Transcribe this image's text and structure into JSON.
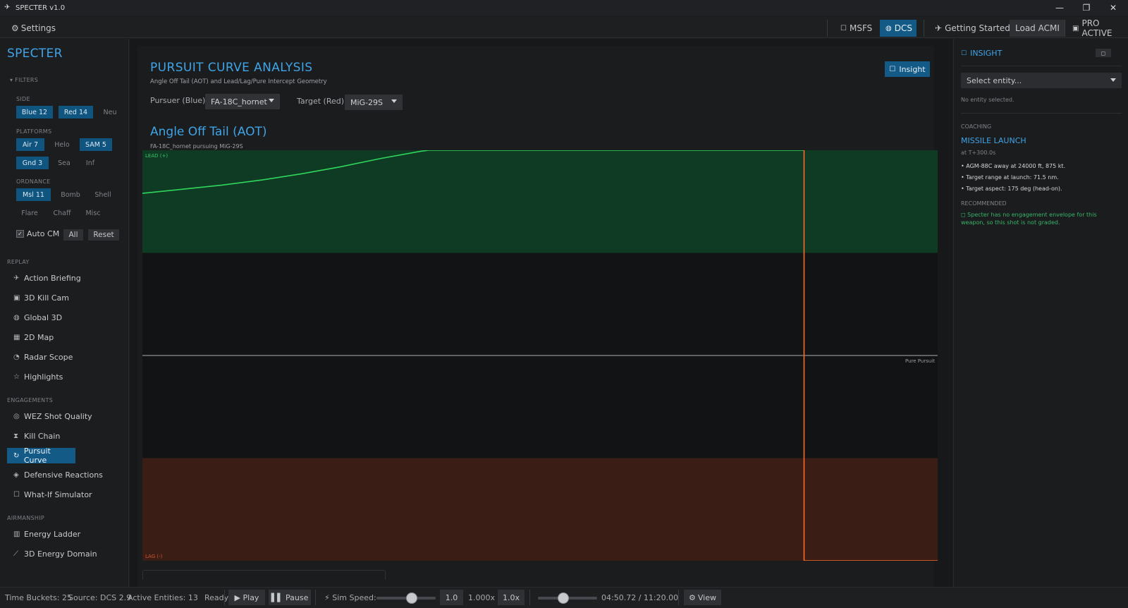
{
  "window": {
    "title": "SPECTER v1.0",
    "min": "—",
    "restore": "❐",
    "close": "✕"
  },
  "toolbar": {
    "settings": "Settings",
    "msfs": "MSFS",
    "dcs": "DCS",
    "getting_started": "Getting Started",
    "load_acmi": "Load ACMI",
    "pro": "PRO ACTIVE"
  },
  "sidebar": {
    "brand": "SPECTER",
    "filters_label": "FILTERS",
    "side_label": "SIDE",
    "side": [
      {
        "label": "Blue  12",
        "on": true
      },
      {
        "label": "Red  14",
        "on": true
      },
      {
        "label": "Neu",
        "on": false
      }
    ],
    "platforms_label": "PLATFORMS",
    "platforms": [
      {
        "label": "Air  7",
        "on": true
      },
      {
        "label": "Helo",
        "on": false
      },
      {
        "label": "SAM  5",
        "on": true
      },
      {
        "label": "Gnd  3",
        "on": true
      },
      {
        "label": "Sea",
        "on": false
      },
      {
        "label": "Inf",
        "on": false
      }
    ],
    "ordnance_label": "ORDNANCE",
    "ordnance": [
      {
        "label": "Msl  11",
        "on": true
      },
      {
        "label": "Bomb",
        "on": false
      },
      {
        "label": "Shell",
        "on": false
      },
      {
        "label": "Flare",
        "on": false
      },
      {
        "label": "Chaff",
        "on": false
      },
      {
        "label": "Misc",
        "on": false
      }
    ],
    "auto_cm": "Auto CM",
    "all": "All",
    "reset": "Reset",
    "replay_label": "REPLAY",
    "replay": [
      {
        "label": "Action Briefing",
        "icon": "jet-icon"
      },
      {
        "label": "3D Kill Cam",
        "icon": "camera-icon"
      },
      {
        "label": "Global 3D",
        "icon": "globe-icon"
      },
      {
        "label": "2D Map",
        "icon": "map-icon"
      },
      {
        "label": "Radar Scope",
        "icon": "radar-icon"
      },
      {
        "label": "Highlights",
        "icon": "star-icon"
      }
    ],
    "engagements_label": "ENGAGEMENTS",
    "engagements": [
      {
        "label": "WEZ Shot Quality",
        "icon": "target-icon"
      },
      {
        "label": "Kill Chain",
        "icon": "hourglass-icon"
      },
      {
        "label": "Pursuit Curve",
        "icon": "sync-icon",
        "active": true
      },
      {
        "label": "Defensive Reactions",
        "icon": "shield-icon"
      },
      {
        "label": "What-If Simulator",
        "icon": "square-icon"
      }
    ],
    "airmanship_label": "AIRMANSHIP",
    "airmanship": [
      {
        "label": "Energy Ladder",
        "icon": "bar-chart-icon"
      },
      {
        "label": "3D Energy Domain",
        "icon": "rocket-icon"
      }
    ]
  },
  "main": {
    "title": "PURSUIT CURVE ANALYSIS",
    "subtitle": "Angle Off Tail (AOT) and Lead/Lag/Pure Intercept Geometry",
    "insight_button": "Insight",
    "pursuer_label": "Pursuer (Blue):",
    "pursuer_value": "FA-18C_hornet",
    "target_label": "Target (Red):",
    "target_value": "MiG-29S",
    "chart_title": "Angle Off Tail (AOT)",
    "chart_subtitle": "FA-18C_hornet pursuing MiG-29S"
  },
  "chart_data": {
    "type": "line",
    "title": "Angle Off Tail (AOT)",
    "zone_labels": {
      "lead": "LEAD (+)",
      "lag": "LAG (-)",
      "pure": "Pure Pursuit"
    },
    "ylim": [
      -1,
      1
    ],
    "zones": [
      {
        "name": "LEAD (+)",
        "from": 0.5,
        "to": 1.0,
        "color": "#0f3b24"
      },
      {
        "name": "LAG (-)",
        "from": -1.0,
        "to": -0.5,
        "color": "#3a1d15"
      }
    ],
    "series": [
      {
        "color": "#2fd65a",
        "x": [
          0,
          0.05,
          0.1,
          0.15,
          0.2,
          0.25,
          0.3,
          0.35,
          0.36,
          0.45,
          0.55,
          0.65,
          0.75,
          0.832
        ],
        "y": [
          0.79,
          0.81,
          0.83,
          0.855,
          0.885,
          0.92,
          0.96,
          0.995,
          1.0,
          1.0,
          1.0,
          1.0,
          1.0,
          1.0
        ]
      },
      {
        "color": "#ff6a2a",
        "x": [
          0.832,
          0.832,
          1.0
        ],
        "y": [
          1.0,
          -1.0,
          -1.0
        ]
      }
    ],
    "colors": {
      "background": "#121315",
      "pure_line": "#cfd3d6"
    }
  },
  "insight": {
    "title": "INSIGHT",
    "close": "◻",
    "select_placeholder": "Select entity...",
    "no_entity": "No entity selected.",
    "coaching_label": "COACHING",
    "event_title": "MISSILE LAUNCH",
    "event_time": "at T+300.0s",
    "bullets": [
      "• AGM-88C away at 24000 ft, 875 kt.",
      "• Target range at launch: 71.5 nm.",
      "• Target aspect: 175 deg (head-on)."
    ],
    "recommended_label": "RECOMMENDED",
    "note": "◻ Specter has no engagement envelope for this weapon, so this shot is not graded."
  },
  "status": {
    "time_buckets": "Time Buckets: 25",
    "source": "Source: DCS 2.9",
    "entities": "Active Entities: 13",
    "ready": "Ready",
    "play": "▶ Play",
    "pause": "▌▌ Pause",
    "sim_speed": "Sim Speed:",
    "speed_value": "1.0",
    "speed_mult": "1.000x",
    "speed_btn": "1.0x",
    "time": "04:50.72 / 11:20.00",
    "view": "View",
    "sim_speed_fraction": 0.6,
    "timeline_fraction": 0.43
  }
}
